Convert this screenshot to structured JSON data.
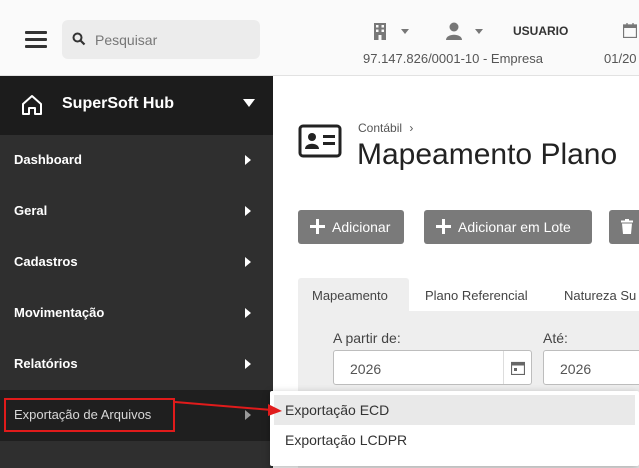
{
  "search": {
    "placeholder": "Pesquisar"
  },
  "sidebar": {
    "hub_title": "SuperSoft Hub",
    "items": [
      {
        "label": "Dashboard"
      },
      {
        "label": "Geral"
      },
      {
        "label": "Cadastros"
      },
      {
        "label": "Movimentação"
      },
      {
        "label": "Relatórios"
      },
      {
        "label": "Exportação de Arquivos"
      }
    ]
  },
  "header": {
    "user_label": "USUARIO",
    "company": "97.147.826/0001-10 - Empresa",
    "date": "01/20"
  },
  "main": {
    "breadcrumb": "Contábil",
    "breadcrumb_sep": "›",
    "title": "Mapeamento Plano",
    "buttons": {
      "add": "Adicionar",
      "add_batch": "Adicionar em Lote"
    },
    "tabs": [
      {
        "label": "Mapeamento"
      },
      {
        "label": "Plano Referencial"
      },
      {
        "label": "Natureza Su"
      }
    ],
    "filters": {
      "from_label": "A partir de:",
      "from_value": "2026",
      "to_label": "Até:",
      "to_value": "2026"
    }
  },
  "submenu": {
    "items": [
      {
        "label": "Exportação ECD"
      },
      {
        "label": "Exportação LCDPR"
      }
    ]
  },
  "colors": {
    "sidebar_bg": "#2f2f2f",
    "annotation": "#e01b1b",
    "button_bg": "#7a7a7a"
  }
}
